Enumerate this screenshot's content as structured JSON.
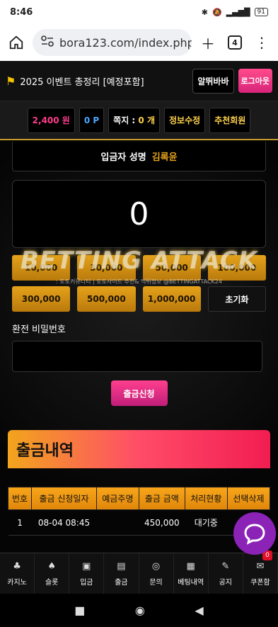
{
  "status": {
    "time": "8:46",
    "battery": "91"
  },
  "browser": {
    "url": "bora123.com/index.php?",
    "tab_count": "4"
  },
  "header": {
    "event_text": "2025 이벤트 총정리 [예정포함]",
    "btn_alwibaba": "알뛰바바",
    "btn_logout": "로그아웃"
  },
  "userbar": {
    "money": "2,400 원",
    "points": "0 P",
    "message_label": "쪽지 :",
    "message_count": "0 개",
    "edit_info": "정보수정",
    "recommend": "추천회원"
  },
  "form": {
    "depositor_label": "입금자 성명",
    "depositor_name": "김록윤",
    "amount": "0",
    "quick_amounts": [
      "10,000",
      "30,000",
      "50,000",
      "100,000",
      "300,000",
      "500,000",
      "1,000,000"
    ],
    "reset_label": "초기화",
    "password_label": "환전 비밀번호",
    "password_value": "",
    "submit_label": "출금신청"
  },
  "watermark": {
    "title": "BETTING ATTACK",
    "subtitle": ": 토토커뮤니티 | 토토사이트 추천& 먹튀정보 @BETTINGATTACK24"
  },
  "history": {
    "title": "출금내역",
    "columns": [
      "번호",
      "출금 신청일자",
      "예금주명",
      "출금 금액",
      "처리현황",
      "선택삭제"
    ],
    "rows": [
      {
        "no": "1",
        "date": "08-04 08:45",
        "holder": "",
        "amount": "450,000",
        "status": "대기중"
      }
    ]
  },
  "bottom_nav": [
    {
      "label": "카지노",
      "icon": "casino-icon"
    },
    {
      "label": "슬롯",
      "icon": "slot-icon"
    },
    {
      "label": "입금",
      "icon": "deposit-icon"
    },
    {
      "label": "출금",
      "icon": "withdraw-icon"
    },
    {
      "label": "문의",
      "icon": "headset-icon"
    },
    {
      "label": "베팅내역",
      "icon": "calendar-icon"
    },
    {
      "label": "공지",
      "icon": "pen-icon"
    },
    {
      "label": "쿠폰함",
      "icon": "coupon-icon",
      "badge": "0"
    }
  ],
  "colors": {
    "accent_gold": "#e6a21a",
    "accent_pink": "#ff3f8e",
    "money_pink": "#ff3c8c",
    "points_blue": "#4da6ff",
    "yellow": "#ffd24a"
  }
}
